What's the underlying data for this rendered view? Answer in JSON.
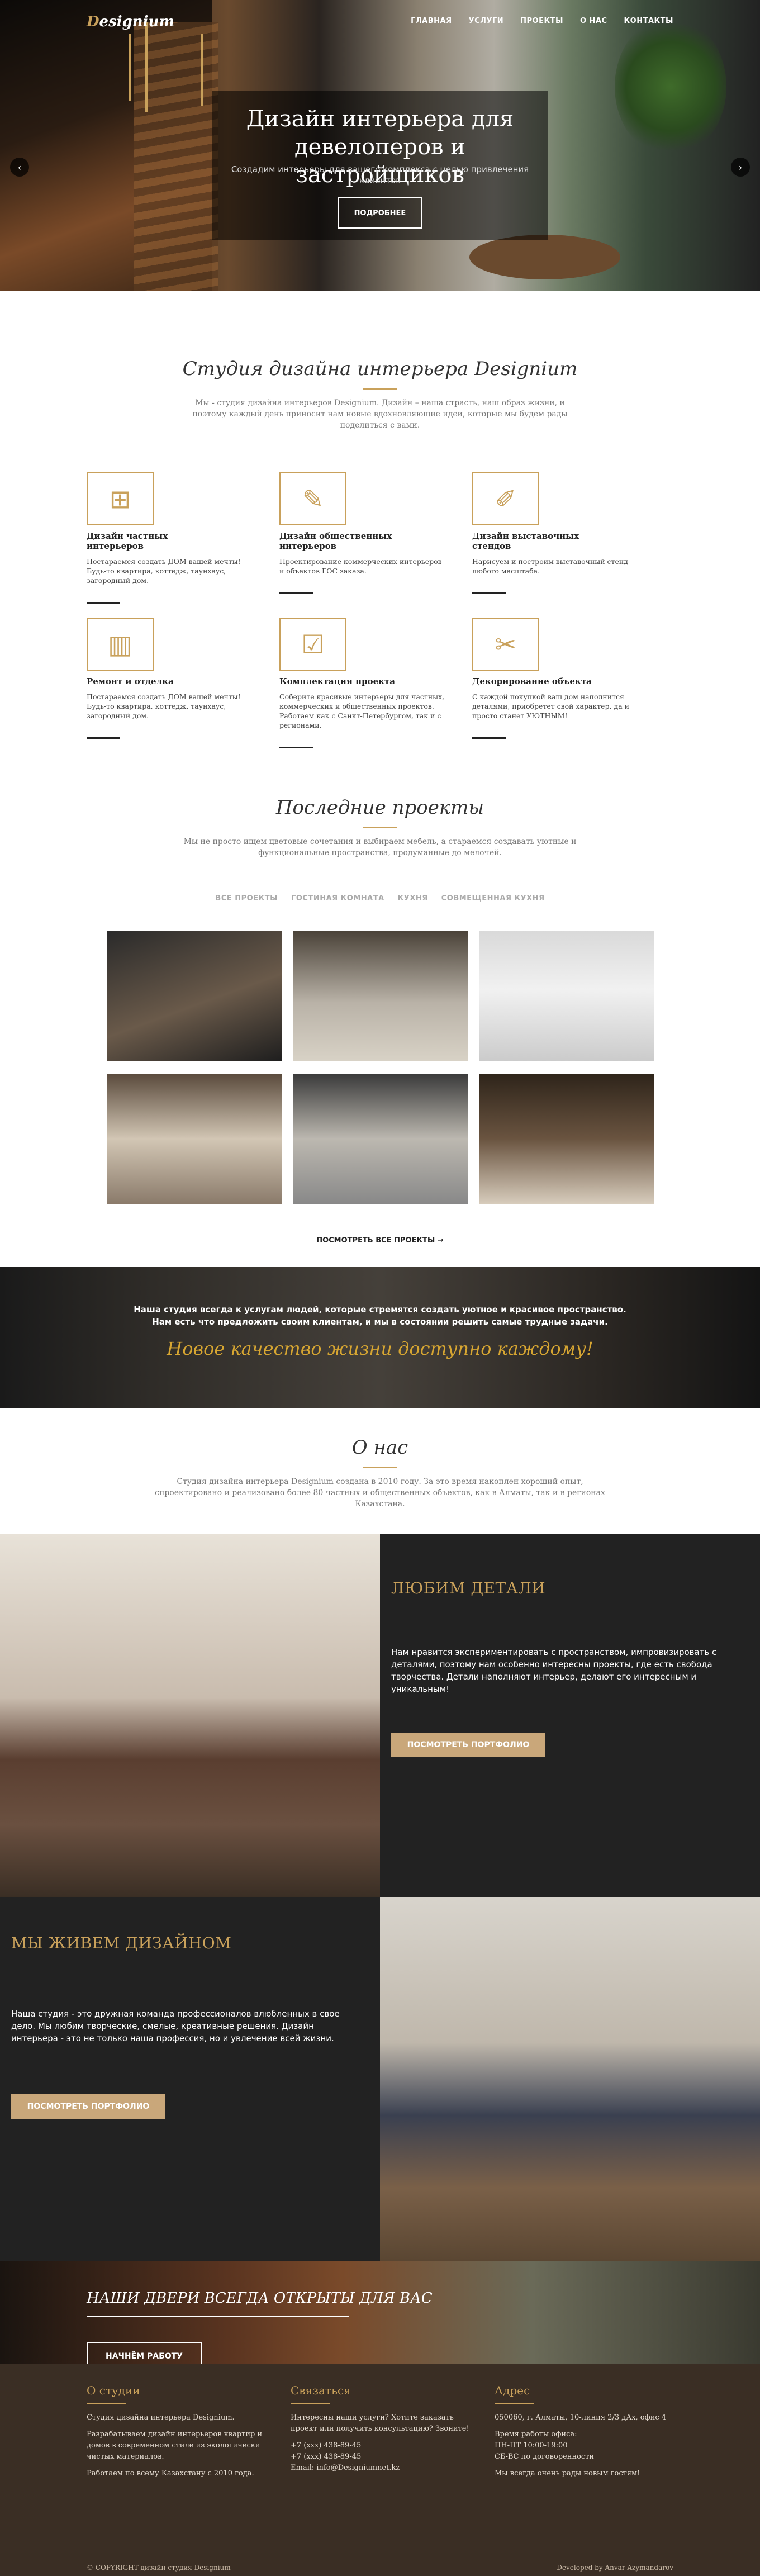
{
  "header": {
    "logo_first": "D",
    "logo_rest": "esignium",
    "nav": [
      "ГЛАВНАЯ",
      "УСЛУГИ",
      "ПРОЕКТЫ",
      "О НАС",
      "КОНТАКТЫ"
    ]
  },
  "hero": {
    "title": "Дизайн интерьера для девелоперов и застройщиков",
    "subtitle": "Создадим интерьеры для вашего комплекса с целью привлечения клиентов",
    "button": "ПОДРОБНЕЕ",
    "prev": "‹",
    "next": "›",
    "slide_count": 3,
    "active_slide": 3
  },
  "studio": {
    "title": "Студия дизайна интерьера Designium",
    "lead": "Мы - студия дизайна интерьеров Designium. Дизайн – наша страсть, наш образ жизни, и поэтому каждый день приносит нам новые вдохновляющие идеи, которые мы будем рады поделиться с вами.",
    "services": [
      {
        "icon": "floorplan-icon",
        "glyph": "⊞",
        "title": "Дизайн частных интерьеров",
        "text": "Постараемся создать ДОМ вашей мечты! Будь-то квартира, коттедж, таунхаус, загородный дом."
      },
      {
        "icon": "ruler-pencil-icon",
        "glyph": "✎",
        "title": "Дизайн общественных интерьеров",
        "text": "Проектирование коммерческих интерьеров и объектов ГОС заказа."
      },
      {
        "icon": "brush-icon",
        "glyph": "✐",
        "title": "Дизайн выставочных стендов",
        "text": "Нарисуем и построим выставочный стенд любого масштаба."
      },
      {
        "icon": "paint-roller-icon",
        "glyph": "▥",
        "title": "Ремонт и отделка",
        "text": "Постараемся создать ДОМ вашей мечты! Будь-то квартира, коттедж, таунхаус, загородный дом."
      },
      {
        "icon": "checklist-icon",
        "glyph": "☑",
        "title": "Комплектация проекта",
        "text": "Соберите красивые интерьеры для частных, коммерческих и общественных проектов. Работаем как с Санкт-Петербургом, так и с регионами."
      },
      {
        "icon": "decor-brush-icon",
        "glyph": "✂",
        "title": "Декорирование объекта",
        "text": "С каждой покупкой ваш дом наполнится деталями, приобретет свой характер, да и просто станет УЮТНЫМ!"
      }
    ]
  },
  "projects": {
    "title": "Последние проекты",
    "lead": "Мы не просто ищем цветовые сочетания и выбираем мебель, а стараемся создавать уютные и функциональные пространства, продуманные до мелочей.",
    "filters": [
      "ВСЕ ПРОЕКТЫ",
      "ГОСТИНАЯ КОМНАТА",
      "КУХНЯ",
      "СОВМЕЩЕННАЯ КУХНЯ"
    ],
    "see_all": "ПОСМОТРЕТЬ ВСЕ ПРОЕКТЫ →"
  },
  "quote": {
    "text": "Наша студия всегда к услугам людей, которые стремятся создать уютное и красивое пространство. Нам есть что предложить своим клиентам, и мы в состоянии решить самые трудные задачи.",
    "headline": "Новое качество жизни доступно каждому!"
  },
  "about": {
    "title": "О нас",
    "text": "Студия дизайна интерьера Designium создана в 2010 году. За это время накоплен хороший опыт, спроектировано и реализовано более 80 частных и общественных объектов, как в Алматы, так и в регионах Казахстана."
  },
  "details": {
    "title": "ЛЮБИМ ДЕТАЛИ",
    "text": "Нам нравится экспериментировать с пространством, импровизировать с деталями, поэтому нам особенно интересны проекты, где есть свобода творчества. Детали наполняют интерьер, делают его интересным и уникальным!",
    "button": "ПОСМОТРЕТЬ ПОРТФОЛИО"
  },
  "live": {
    "title": "МЫ ЖИВЕМ ДИЗАЙНОМ",
    "text": "Наша студия - это дружная команда профессионалов влюбленных в свое дело. Мы любим творческие, смелые, креативные решения. Дизайн интерьера - это не только наша профессия, но и увлечение всей жизни.",
    "button": "ПОСМОТРЕТЬ ПОРТФОЛИО"
  },
  "doors": {
    "title": "НАШИ ДВЕРИ ВСЕГДА ОТКРЫТЫ ДЛЯ ВАС",
    "button": "НАЧНЁМ РАБОТУ"
  },
  "footer": {
    "about": {
      "title": "О студии",
      "lines": [
        "Студия дизайна интерьера Designium.",
        "Разрабатываем дизайн интерьеров квартир и домов в современном стиле из экологически чистых материалов.",
        "Работаем по всему Казахстану с 2010 года."
      ]
    },
    "contact": {
      "title": "Связаться",
      "lines": [
        "Интересны наши услуги? Хотите заказать проект или получить консультацию? Звоните!",
        "+7 (xxx) 438-89-45",
        "+7 (xxx) 438-89-45",
        "Email: info@Designiumnet.kz"
      ]
    },
    "address": {
      "title": "Адрес",
      "lines": [
        "050060, г. Алматы, 10-линия 2/3 дАх, офис 4",
        "Время работы офиса:",
        "ПН-ПТ 10:00-19:00",
        "СБ-ВС по договоренности",
        "Мы всегда очень рады новым гостям!"
      ]
    },
    "copyright": "© COPYRIGHT дизайн студия Designium",
    "developer": "Developed by Anvar Azymandarov"
  }
}
